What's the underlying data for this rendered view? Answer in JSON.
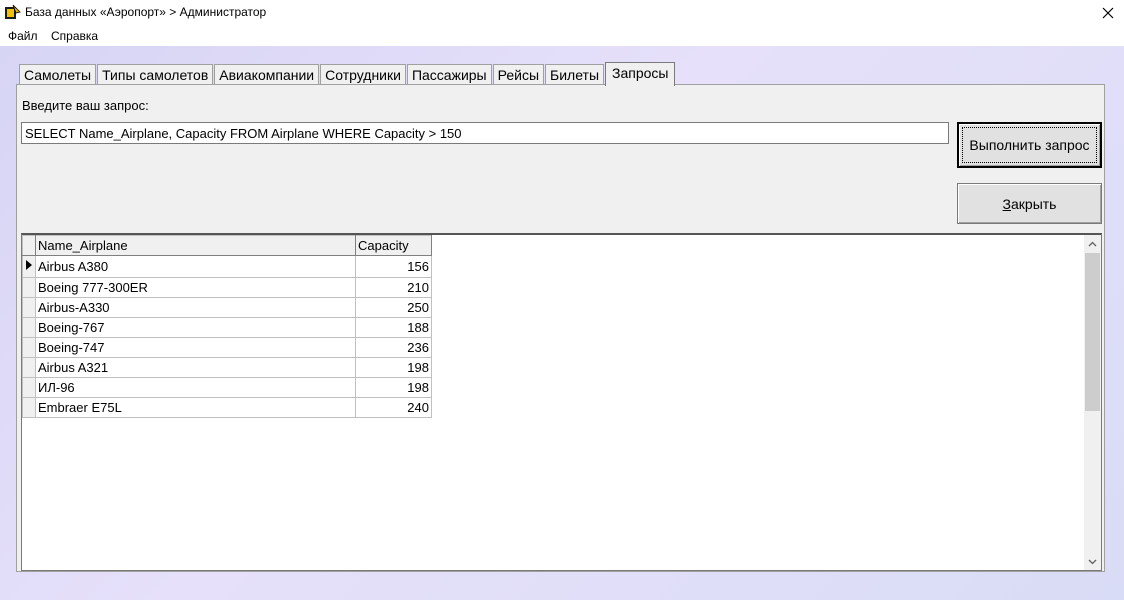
{
  "window": {
    "title": "База данных «Аэропорт» > Администратор",
    "icon": "app-icon",
    "close_icon": "close-icon"
  },
  "menu": {
    "file": "Файл",
    "help": "Справка"
  },
  "tabs": [
    {
      "label": "Самолеты",
      "active": false
    },
    {
      "label": "Типы самолетов",
      "active": false
    },
    {
      "label": "Авиакомпании",
      "active": false
    },
    {
      "label": "Сотрудники",
      "active": false
    },
    {
      "label": "Пассажиры",
      "active": false
    },
    {
      "label": "Рейсы",
      "active": false
    },
    {
      "label": "Билеты",
      "active": false
    },
    {
      "label": "Запросы",
      "active": true
    }
  ],
  "query": {
    "label": "Введите ваш запрос:",
    "value": "SELECT Name_Airplane, Capacity FROM Airplane WHERE Capacity > 150"
  },
  "buttons": {
    "run_label": "Выполнить запрос",
    "close_label": "Закрыть"
  },
  "grid": {
    "columns": [
      "Name_Airplane",
      "Capacity"
    ],
    "rows": [
      {
        "name": "Airbus A380",
        "capacity": "156"
      },
      {
        "name": "Boeing 777-300ER",
        "capacity": "210"
      },
      {
        "name": "Airbus-A330",
        "capacity": "250"
      },
      {
        "name": "Boeing-767",
        "capacity": "188"
      },
      {
        "name": "Boeing-747",
        "capacity": "236"
      },
      {
        "name": "Airbus A321",
        "capacity": "198"
      },
      {
        "name": "ИЛ-96",
        "capacity": "198"
      },
      {
        "name": "Embraer E75L",
        "capacity": "240"
      }
    ],
    "current_row_icon": "current-row-arrow-icon"
  }
}
